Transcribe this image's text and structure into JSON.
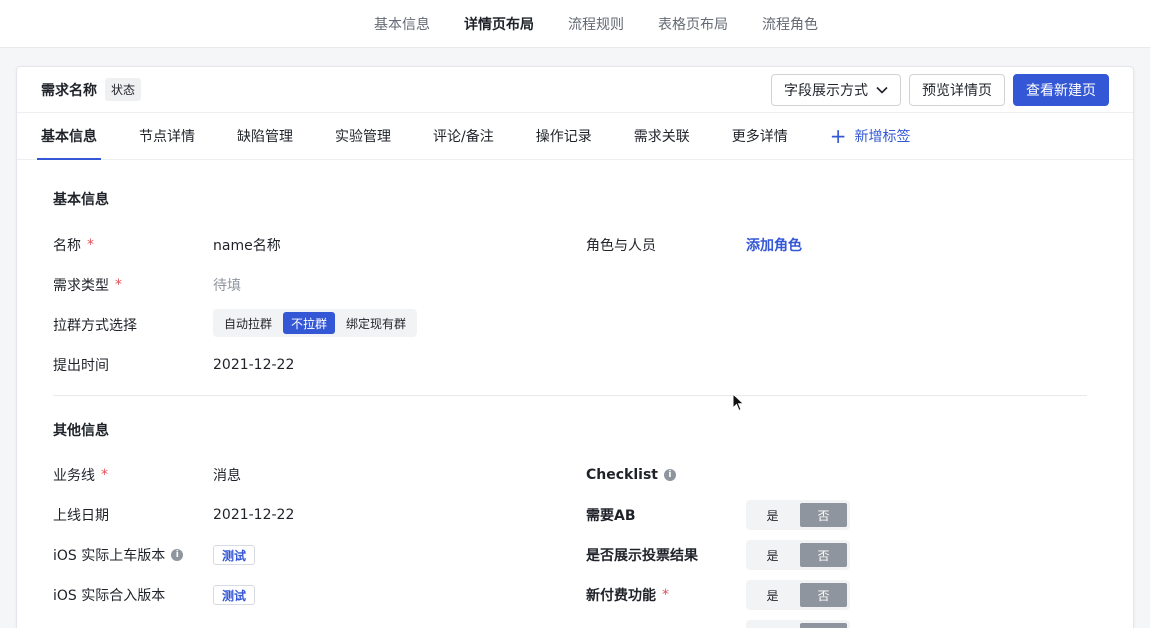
{
  "top_tabs": [
    "基本信息",
    "详情页布局",
    "流程规则",
    "表格页布局",
    "流程角色"
  ],
  "header": {
    "title": "需求名称",
    "status": "状态",
    "field_display_btn": "字段展示方式",
    "preview_btn": "预览详情页",
    "view_new_btn": "查看新建页"
  },
  "detail_tabs": [
    "基本信息",
    "节点详情",
    "缺陷管理",
    "实验管理",
    "评论/备注",
    "操作记录",
    "需求关联",
    "更多详情"
  ],
  "add_tab": "新增标签",
  "basic": {
    "title": "基本信息",
    "name_label": "名称",
    "name_value": "name名称",
    "role_label": "角色与人员",
    "add_role": "添加角色",
    "type_label": "需求类型",
    "type_value": "待填",
    "group_label": "拉群方式选择",
    "group_options": [
      "自动拉群",
      "不拉群",
      "绑定现有群"
    ],
    "group_selected": "不拉群",
    "time_label": "提出时间",
    "time_value": "2021-12-22"
  },
  "other": {
    "title": "其他信息",
    "business_label": "业务线",
    "business_value": "消息",
    "online_label": "上线日期",
    "online_value": "2021-12-22",
    "ios_ver_label": "iOS 实际上车版本",
    "ios_ver_chip": "测试",
    "ios_merge_label": "iOS 实际合入版本",
    "ios_merge_chip": "测试",
    "checklist_label": "Checklist",
    "ab_label": "需要AB",
    "vote_label": "是否展示投票结果",
    "pay_label": "新付费功能",
    "yes": "是",
    "no": "否"
  },
  "colors": {
    "accent": "#3457d5",
    "required": "#e34d59",
    "selected_gray": "#8f959e"
  }
}
